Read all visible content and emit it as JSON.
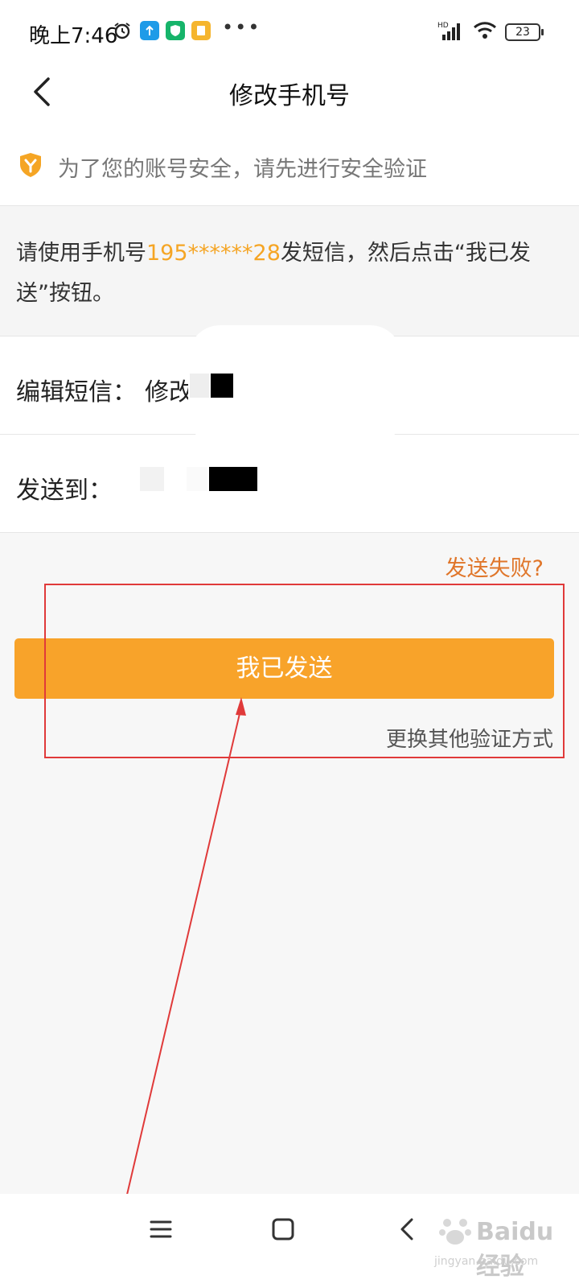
{
  "status_bar": {
    "time": "晚上7:46",
    "battery": "23",
    "network": "HD"
  },
  "header": {
    "title": "修改手机号"
  },
  "notice": {
    "text": "为了您的账号安全，请先进行安全验证"
  },
  "instruction": {
    "prefix": "请使用手机号",
    "phone": "195******28",
    "suffix": "发短信，然后点击“我已发送”按钮。"
  },
  "sms_row": {
    "label": "编辑短信：",
    "value": "修改"
  },
  "send_to_row": {
    "label": "发送到："
  },
  "send_failed_link": "发送失败?",
  "primary_button": "我已发送",
  "alt_method_link": "更换其他验证方式",
  "colors": {
    "accent_orange": "#f8a32a",
    "phone_highlight": "#f5a524",
    "fail_link": "#e0762a",
    "annotation_red": "#e03a3a"
  },
  "watermark": {
    "logo_text": "Baidu经验",
    "url": "jingyan.baidu.com"
  }
}
